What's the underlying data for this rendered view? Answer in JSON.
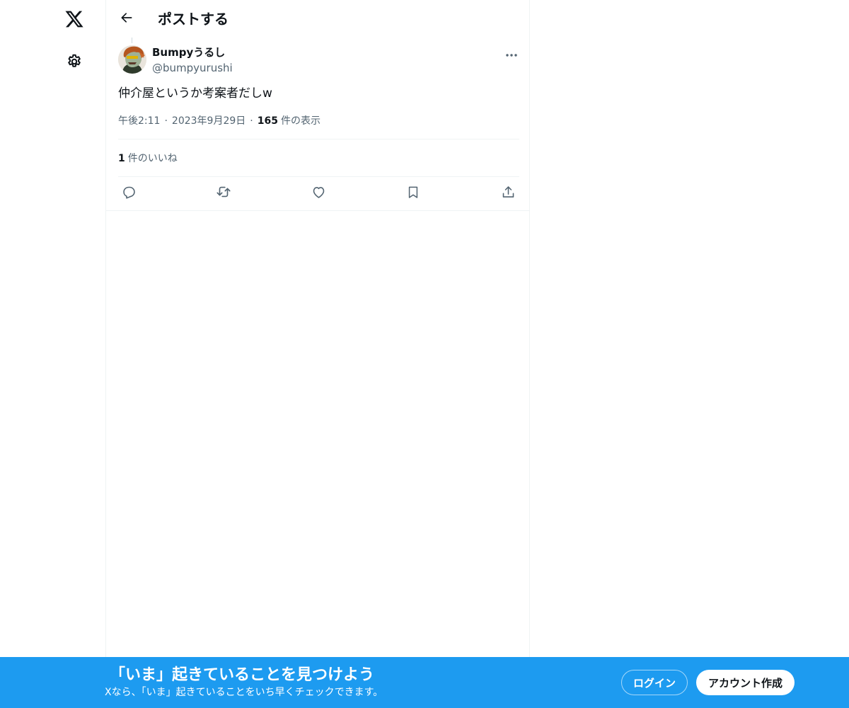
{
  "header": {
    "title": "ポストする"
  },
  "post": {
    "author": {
      "display_name": "Bumpyうるし",
      "handle": "@bumpyurushi"
    },
    "text": "仲介屋というか考案者だしw",
    "time": "午後2:11",
    "date": "2023年9月29日",
    "separator": "·",
    "views_count": "165",
    "views_label": "件の表示",
    "likes_count": "1",
    "likes_label": "件のいいね"
  },
  "icons": {
    "logo": "x-logo-icon",
    "settings": "gear-icon",
    "back": "arrow-left-icon",
    "more": "more-dots-icon",
    "reply": "reply-icon",
    "repost": "repost-icon",
    "like": "heart-icon",
    "bookmark": "bookmark-icon",
    "share": "share-icon"
  },
  "bottom_bar": {
    "title": "「いま」起きていることを見つけよう",
    "subtitle": "Xなら、「いま」起きていることをいち早くチェックできます。",
    "login_label": "ログイン",
    "signup_label": "アカウント作成",
    "background": "#1d9bf0"
  }
}
